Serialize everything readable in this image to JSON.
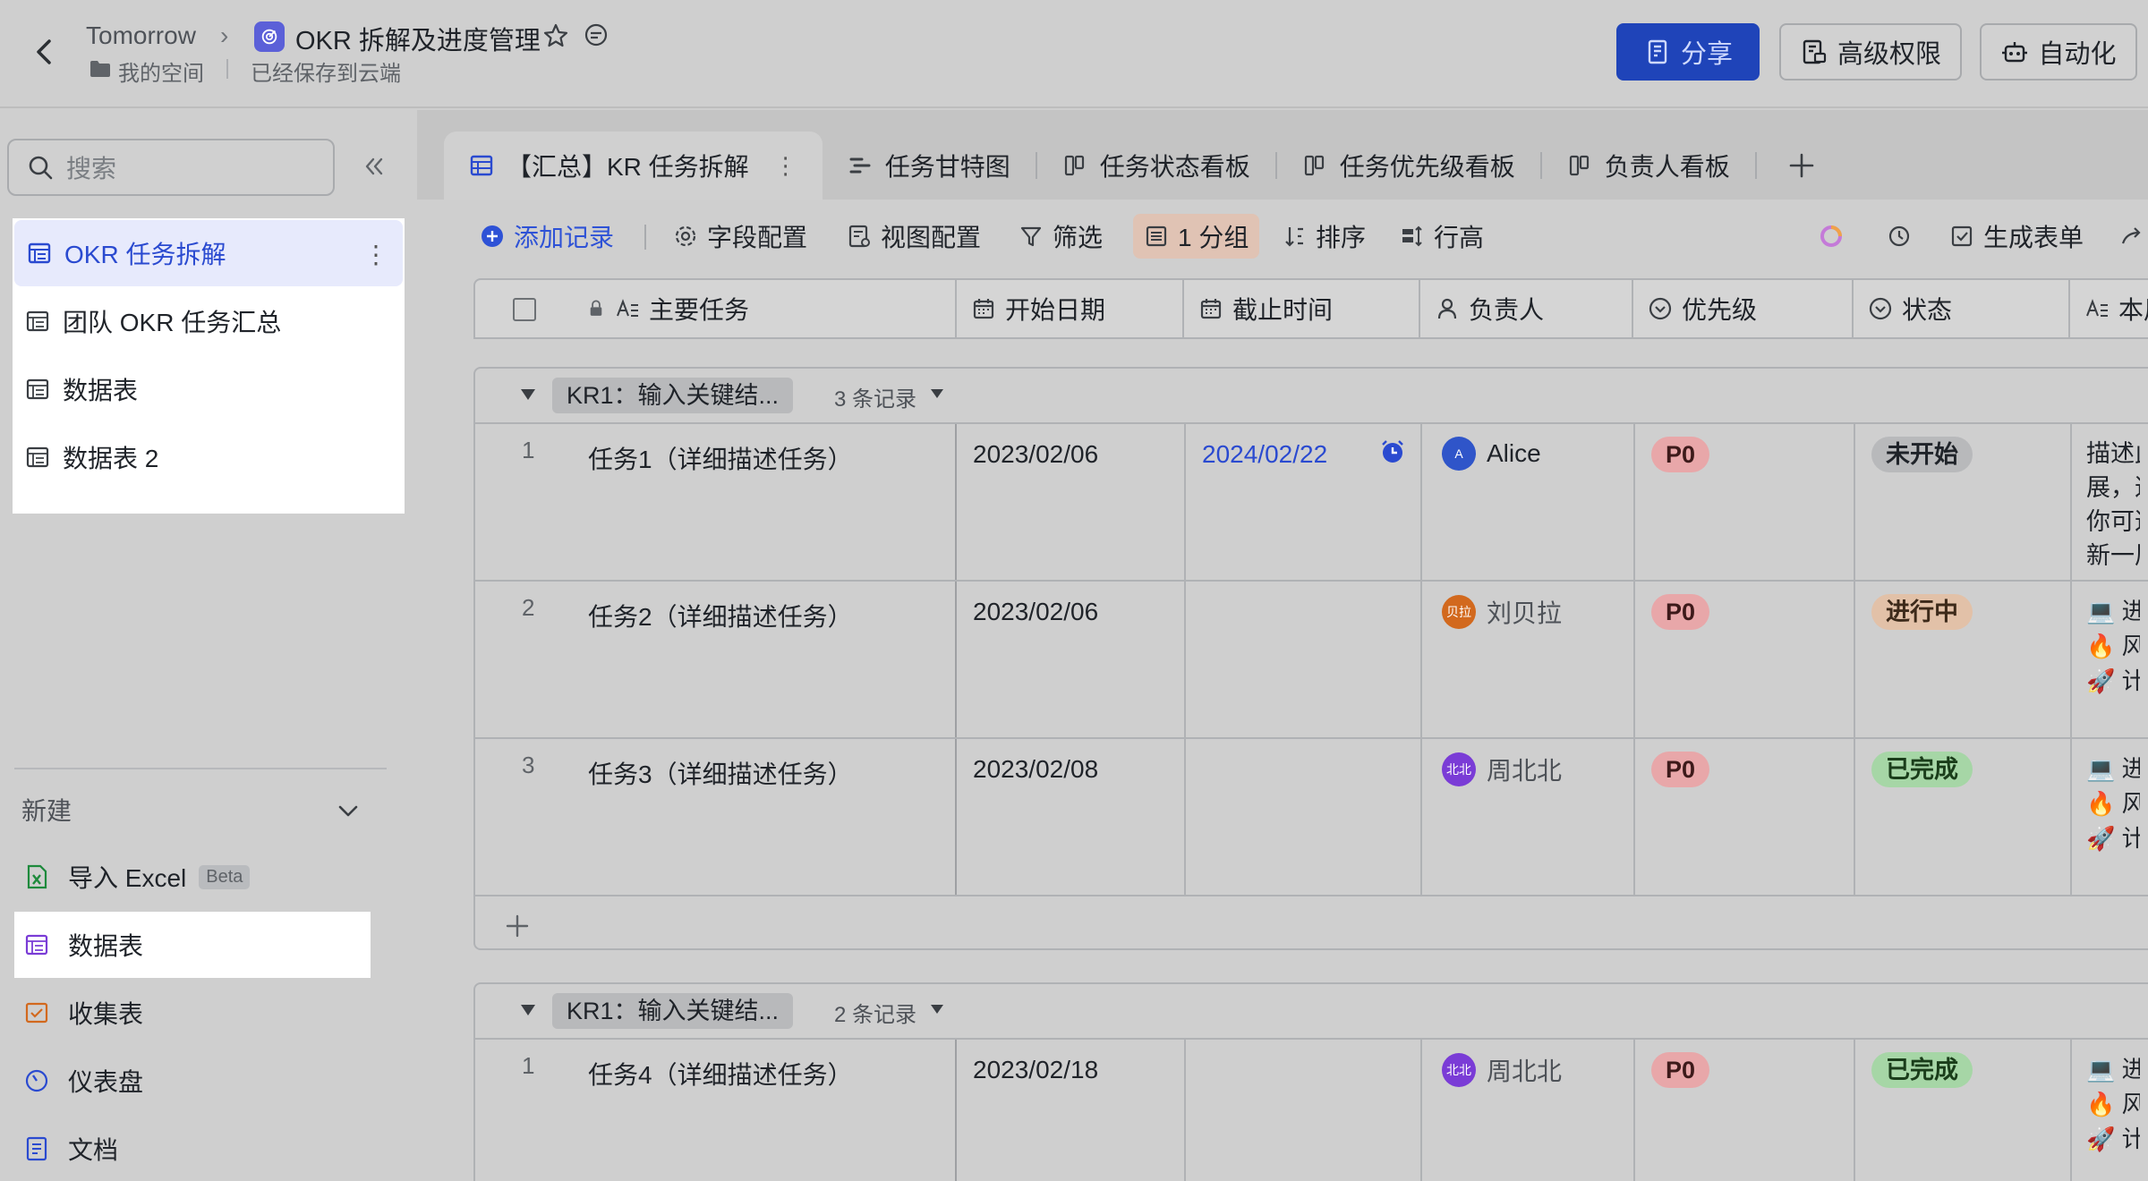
{
  "header": {
    "workspace": "Tomorrow",
    "doc_title": "OKR 拆解及进度管理",
    "space": "我的空间",
    "saved": "已经保存到云端",
    "share": "分享",
    "permissions": "高级权限",
    "automation": "自动化"
  },
  "sidebar": {
    "search_placeholder": "搜索",
    "tables": [
      {
        "label": "OKR 任务拆解"
      },
      {
        "label": "团队 OKR 任务汇总"
      },
      {
        "label": "数据表"
      },
      {
        "label": "数据表 2"
      }
    ],
    "new_label": "新建",
    "create": [
      {
        "label": "导入 Excel",
        "badge": "Beta"
      },
      {
        "label": "数据表"
      },
      {
        "label": "收集表"
      },
      {
        "label": "仪表盘"
      },
      {
        "label": "文档"
      }
    ]
  },
  "tabs": [
    {
      "label": "【汇总】KR 任务拆解"
    },
    {
      "label": "任务甘特图"
    },
    {
      "label": "任务状态看板"
    },
    {
      "label": "任务优先级看板"
    },
    {
      "label": "负责人看板"
    }
  ],
  "toolbar": {
    "add_record": "添加记录",
    "fields": "字段配置",
    "view": "视图配置",
    "filter": "筛选",
    "group": "1 分组",
    "sort": "排序",
    "row_height": "行高",
    "generate_form": "生成表单"
  },
  "columns": {
    "task": "主要任务",
    "start": "开始日期",
    "due": "截止时间",
    "owner": "负责人",
    "priority": "优先级",
    "status": "状态",
    "weekly": "本周"
  },
  "groups": [
    {
      "label": "KR1：输入关键结...",
      "count": "3 条记录",
      "rows": [
        {
          "num": "1",
          "task": "任务1（详细描述任务）",
          "start": "2023/02/06",
          "due": "2024/02/22",
          "owner": "Alice",
          "owner_initial": "A",
          "priority": "P0",
          "status": "未开始",
          "note": [
            "描述此",
            "展，这",
            "你可这",
            "新一周"
          ]
        },
        {
          "num": "2",
          "task": "任务2（详细描述任务）",
          "start": "2023/02/06",
          "due": "",
          "owner": "刘贝拉",
          "owner_initial": "贝拉",
          "priority": "P0",
          "status": "进行中",
          "note": [
            "💻 进",
            "🔥 风",
            "🚀 计"
          ]
        },
        {
          "num": "3",
          "task": "任务3（详细描述任务）",
          "start": "2023/02/08",
          "due": "",
          "owner": "周北北",
          "owner_initial": "北北",
          "priority": "P0",
          "status": "已完成",
          "note": [
            "💻 进",
            "🔥 风",
            "🚀 计"
          ]
        }
      ]
    },
    {
      "label": "KR1：输入关键结...",
      "count": "2 条记录",
      "rows": [
        {
          "num": "1",
          "task": "任务4（详细描述任务）",
          "start": "2023/02/18",
          "due": "",
          "owner": "周北北",
          "owner_initial": "北北",
          "priority": "P0",
          "status": "已完成",
          "note": [
            "💻 进",
            "🔥 风",
            "🚀 计"
          ]
        }
      ]
    }
  ],
  "colors": {
    "accent": "#2a4ad0",
    "share_bg": "#1f44b9",
    "p0": "#e8a7a9",
    "done": "#a6d6a6",
    "doing": "#e2c1a8"
  }
}
